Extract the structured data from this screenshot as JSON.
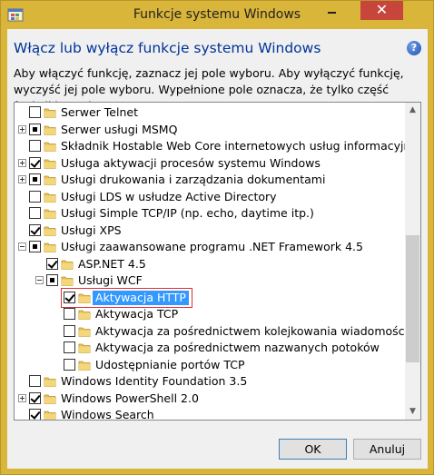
{
  "window": {
    "title": "Funkcje systemu Windows",
    "close_glyph": "✕",
    "accent": "#d9b53a",
    "close_color": "#c7463b"
  },
  "dialog": {
    "heading": "Włącz lub wyłącz funkcje systemu Windows",
    "help_glyph": "?",
    "instructions": "Aby włączyć funkcję, zaznacz jej pole wyboru. Aby wyłączyć funkcję, wyczyść jej pole wyboru. Wypełnione pole oznacza, że tylko część funkcji jest włączona."
  },
  "tree": {
    "items": [
      {
        "label": "Serwer Telnet",
        "state": "unchecked",
        "expander": "none",
        "level": 0
      },
      {
        "label": "Serwer usługi MSMQ",
        "state": "partial",
        "expander": "plus",
        "level": 0
      },
      {
        "label": "Składnik Hostable Web Core internetowych usług informacyjnych",
        "state": "unchecked",
        "expander": "none",
        "level": 0
      },
      {
        "label": "Usługa aktywacji procesów systemu Windows",
        "state": "checked",
        "expander": "plus",
        "level": 0
      },
      {
        "label": "Usługi drukowania i zarządzania dokumentami",
        "state": "partial",
        "expander": "plus",
        "level": 0
      },
      {
        "label": "Usługi LDS w usłudze Active Directory",
        "state": "unchecked",
        "expander": "none",
        "level": 0
      },
      {
        "label": "Usługi Simple TCP/IP (np. echo, daytime itp.)",
        "state": "unchecked",
        "expander": "none",
        "level": 0
      },
      {
        "label": "Usługi XPS",
        "state": "checked",
        "expander": "none",
        "level": 0
      },
      {
        "label": "Usługi zaawansowane programu .NET Framework 4.5",
        "state": "partial",
        "expander": "minus",
        "level": 0
      },
      {
        "label": "ASP.NET 4.5",
        "state": "checked",
        "expander": "none",
        "level": 1
      },
      {
        "label": "Usługi WCF",
        "state": "partial",
        "expander": "minus",
        "level": 1
      },
      {
        "label": "Aktywacja HTTP",
        "state": "checked",
        "expander": "none",
        "level": 2,
        "selected": true
      },
      {
        "label": "Aktywacja TCP",
        "state": "unchecked",
        "expander": "none",
        "level": 2
      },
      {
        "label": "Aktywacja za pośrednictwem kolejkowania wiadomości (MSMQ)",
        "state": "unchecked",
        "expander": "none",
        "level": 2
      },
      {
        "label": "Aktywacja za pośrednictwem nazwanych potoków",
        "state": "unchecked",
        "expander": "none",
        "level": 2
      },
      {
        "label": "Udostępnianie portów TCP",
        "state": "unchecked",
        "expander": "none",
        "level": 2
      },
      {
        "label": "Windows Identity Foundation 3.5",
        "state": "unchecked",
        "expander": "none",
        "level": 0
      },
      {
        "label": "Windows PowerShell 2.0",
        "state": "checked",
        "expander": "plus",
        "level": 0
      },
      {
        "label": "Windows Search",
        "state": "checked",
        "expander": "none",
        "level": 0
      }
    ]
  },
  "buttons": {
    "ok": "OK",
    "cancel": "Anuluj"
  }
}
